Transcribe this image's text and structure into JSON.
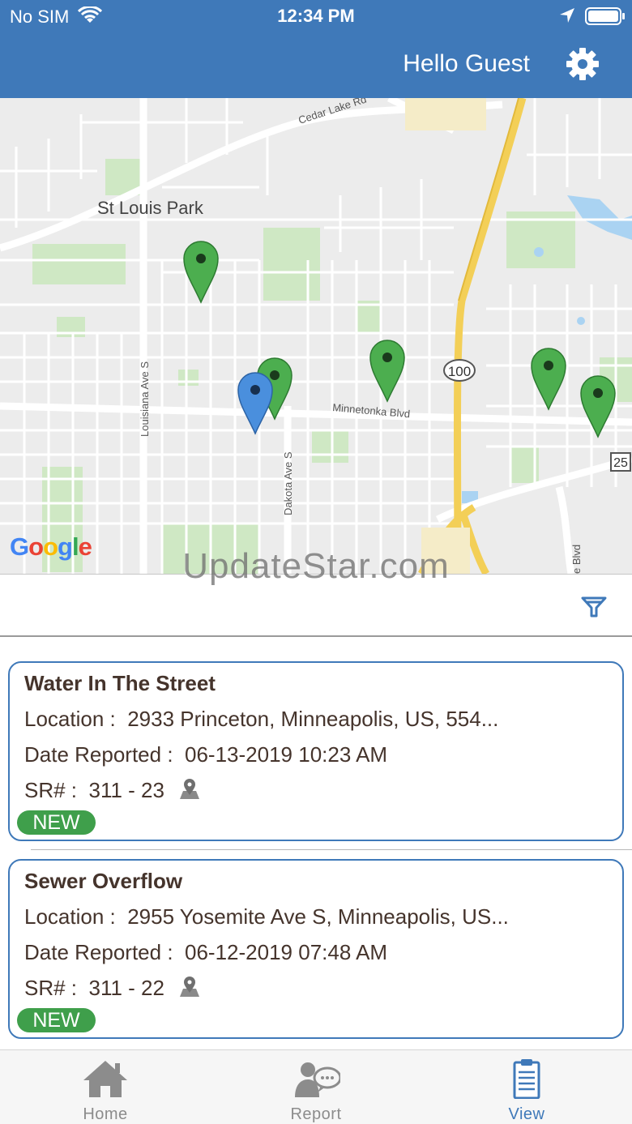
{
  "status_bar": {
    "carrier": "No SIM",
    "time": "12:34 PM"
  },
  "header": {
    "greeting": "Hello Guest"
  },
  "map": {
    "labels": {
      "area": "St Louis Park",
      "cedar": "Cedar Lake Rd",
      "louisiana": "Louisiana Ave S",
      "dakota": "Dakota Ave S",
      "minnetonka": "Minnetonka Blvd",
      "hwy100": "100",
      "hwy25": "25",
      "blvd": "e Blvd"
    },
    "google": [
      "G",
      "o",
      "o",
      "g",
      "l",
      "e"
    ]
  },
  "watermark": "UpdateStar.com",
  "reports": [
    {
      "title": "Water In The Street",
      "location_label": "Location :",
      "location": "2933 Princeton, Minneapolis, US, 554...",
      "date_label": "Date Reported :",
      "date": "06-13-2019 10:23 AM",
      "sr_label": "SR# :",
      "sr": "311 - 23",
      "status": "NEW"
    },
    {
      "title": "Sewer Overflow",
      "location_label": "Location :",
      "location": "2955 Yosemite Ave S, Minneapolis, US...",
      "date_label": "Date Reported :",
      "date": "06-12-2019 07:48 AM",
      "sr_label": "SR# :",
      "sr": "311 - 22",
      "status": "NEW"
    }
  ],
  "tabs": [
    {
      "label": "Home",
      "icon": "home-icon"
    },
    {
      "label": "Report",
      "icon": "report-chat-icon"
    },
    {
      "label": "View",
      "icon": "clipboard-icon"
    }
  ],
  "colors": {
    "header": "#3f79b9",
    "marker_green": "#4cae4f",
    "marker_blue": "#4a8fdd",
    "badge": "#3f9f4b",
    "text": "#45342c"
  }
}
